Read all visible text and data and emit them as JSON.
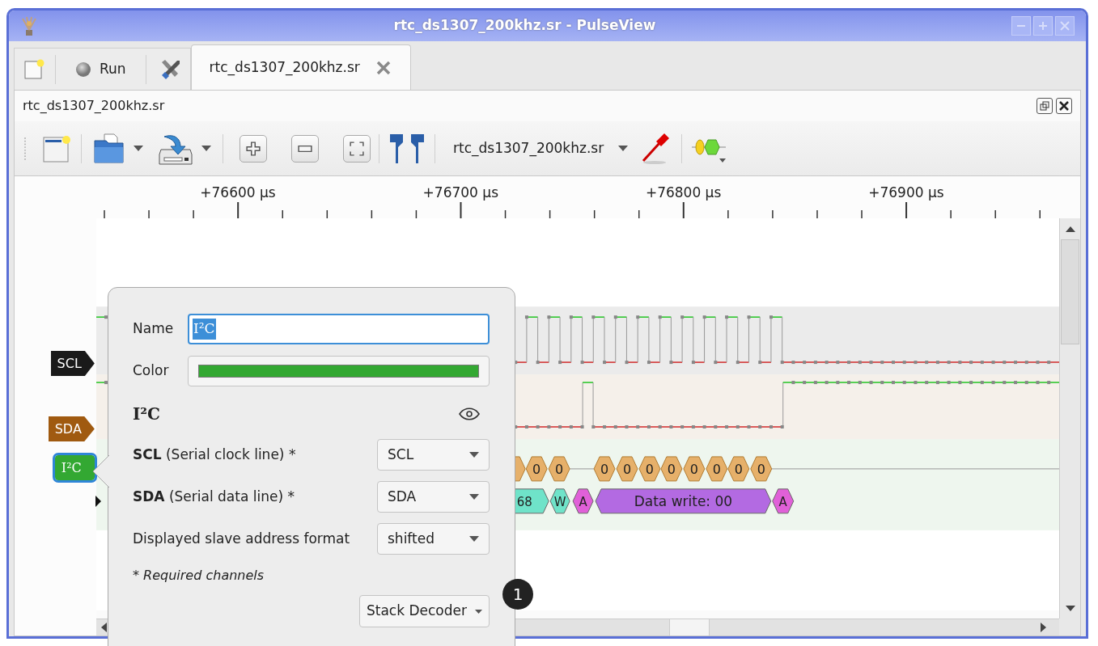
{
  "window": {
    "title": "rtc_ds1307_200khz.sr - PulseView"
  },
  "main_toolbar": {
    "run_label": "Run"
  },
  "tabs": [
    {
      "label": "rtc_ds1307_200khz.sr",
      "selected": true
    }
  ],
  "session": {
    "title": "rtc_ds1307_200khz.sr"
  },
  "toolbar": {
    "device": "rtc_ds1307_200khz.sr"
  },
  "ruler": {
    "labels": [
      "+76600 µs",
      "+76700 µs",
      "+76800 µs",
      "+76900 µs"
    ]
  },
  "signals": [
    {
      "name": "SCL",
      "kind": "logic",
      "color": "#1a1a1a",
      "selected": false
    },
    {
      "name": "SDA",
      "kind": "logic",
      "color": "#a05a10",
      "selected": false
    },
    {
      "name": "I²C",
      "kind": "decoder",
      "color": "#33a832",
      "selected": true
    }
  ],
  "decoder": {
    "bits": [
      "0",
      "0",
      "0",
      "0",
      "0",
      "0",
      "0",
      "0",
      "0",
      "0"
    ],
    "annotations": [
      {
        "text": "68",
        "color": "#6fe3c9"
      },
      {
        "text": "W",
        "color": "#6fe3c9"
      },
      {
        "text": "A",
        "color": "#e060d8"
      },
      {
        "text": "Data write: 00",
        "color": "#b36ae2"
      },
      {
        "text": "A",
        "color": "#e060d8"
      }
    ]
  },
  "popup": {
    "name_label": "Name",
    "name_value": "I²C",
    "name_selected": true,
    "color_label": "Color",
    "color": "#33a832",
    "title": "I²C",
    "channels": [
      {
        "label": "**SCL** (Serial clock line) *",
        "value": "SCL"
      },
      {
        "label": "**SDA** (Serial data line) *",
        "value": "SDA"
      },
      {
        "label": "Displayed slave address format",
        "value": "shifted"
      }
    ],
    "note": "* Required channels",
    "stack_button": "Stack Decoder"
  },
  "callout": "1"
}
